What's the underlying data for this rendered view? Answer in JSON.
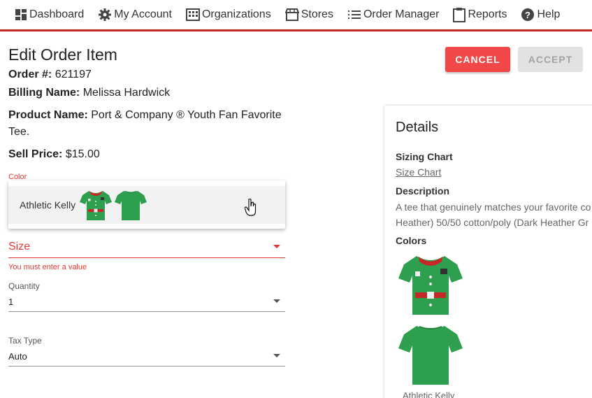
{
  "nav": {
    "items": [
      {
        "label": "Dashboard",
        "icon": "dashboard-icon"
      },
      {
        "label": "My Account",
        "icon": "gear-icon"
      },
      {
        "label": "Organizations",
        "icon": "building-icon"
      },
      {
        "label": "Stores",
        "icon": "store-icon"
      },
      {
        "label": "Order Manager",
        "icon": "list-icon"
      },
      {
        "label": "Reports",
        "icon": "clipboard-icon"
      },
      {
        "label": "Help",
        "icon": "help-icon"
      }
    ],
    "accent_color": "#c62828"
  },
  "page": {
    "title": "Edit Order Item",
    "order_label": "Order #:",
    "order_value": "621197",
    "billing_label": "Billing Name:",
    "billing_value": "Melissa Hardwick",
    "product_label": "Product Name:",
    "product_value": "Port & Company ® Youth Fan Favorite Tee.",
    "price_label": "Sell Price:",
    "price_value": "$15.00"
  },
  "actions": {
    "cancel": "CANCEL",
    "accept": "ACCEPT"
  },
  "form": {
    "color_label": "Color",
    "color_option": "Athletic Kelly",
    "size_label": "Size",
    "size_error": "You must enter a value",
    "quantity_label": "Quantity",
    "quantity_value": "1",
    "tax_label": "Tax Type",
    "tax_value": "Auto",
    "error_color": "#e53935"
  },
  "details": {
    "title": "Details",
    "sizing_heading": "Sizing Chart",
    "sizing_link": "Size Chart",
    "description_heading": "Description",
    "description_line1": "A tee that genuinely matches your favorite co",
    "description_line2": "Heather) 50/50 cotton/poly (Dark Heather Gr",
    "colors_heading": "Colors",
    "color_caption": "Athletic Kelly"
  },
  "colors": {
    "shirt_green": "#2e9e4f",
    "cancel_bg": "#f04848"
  }
}
